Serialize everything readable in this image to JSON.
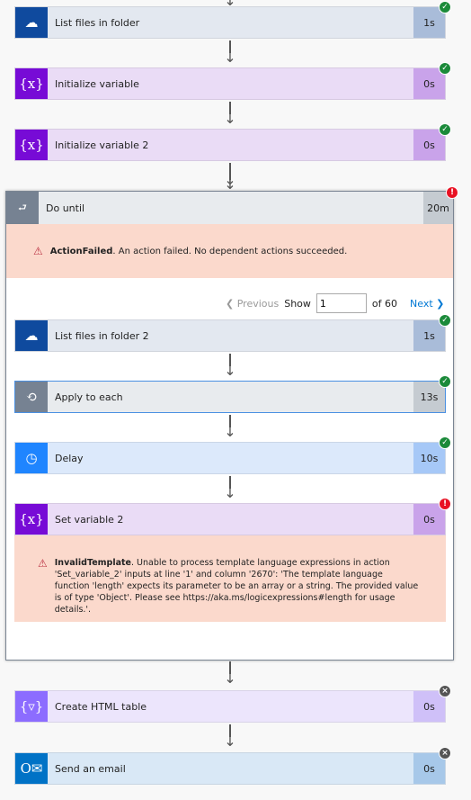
{
  "top_cards": [
    {
      "label": "List files in folder",
      "duration": "1s",
      "icon": "onedrive-cloud-icon",
      "status": "succeeded"
    },
    {
      "label": "Initialize variable",
      "duration": "0s",
      "icon": "variable-icon",
      "status": "succeeded"
    },
    {
      "label": "Initialize variable 2",
      "duration": "0s",
      "icon": "variable-icon",
      "status": "succeeded"
    }
  ],
  "do_until": {
    "label": "Do until",
    "duration": "20m",
    "icon": "do-until-icon",
    "status": "failed",
    "error_code": "ActionFailed",
    "error_message": ". An action failed. No dependent actions succeeded.",
    "pager": {
      "previous": "Previous",
      "show": "Show",
      "value": "1",
      "of": "of 60",
      "next": "Next"
    },
    "inner_cards": [
      {
        "label": "List files in folder 2",
        "duration": "1s",
        "icon": "onedrive-cloud-icon",
        "status": "succeeded"
      },
      {
        "label": "Apply to each",
        "duration": "13s",
        "icon": "loop-icon",
        "status": "succeeded"
      },
      {
        "label": "Delay",
        "duration": "10s",
        "icon": "timer-icon",
        "status": "succeeded"
      },
      {
        "label": "Set variable 2",
        "duration": "0s",
        "icon": "variable-icon",
        "status": "failed"
      }
    ],
    "set_var_error_code": "InvalidTemplate",
    "set_var_error_message": ". Unable to process template language expressions in action 'Set_variable_2' inputs at line '1' and column '2670': 'The template language function 'length' expects its parameter to be an array or a string. The provided value is of type 'Object'. Please see https://aka.ms/logicexpressions#length for usage details.'."
  },
  "bottom_cards": [
    {
      "label": "Create HTML table",
      "duration": "0s",
      "icon": "data-operation-icon",
      "status": "skipped"
    },
    {
      "label": "Send an email",
      "duration": "0s",
      "icon": "outlook-icon",
      "status": "skipped"
    }
  ],
  "colors": {
    "success": "#1b8a3a",
    "error": "#e81123",
    "skipped": "#555555",
    "error_bg": "#fbd9cc"
  }
}
